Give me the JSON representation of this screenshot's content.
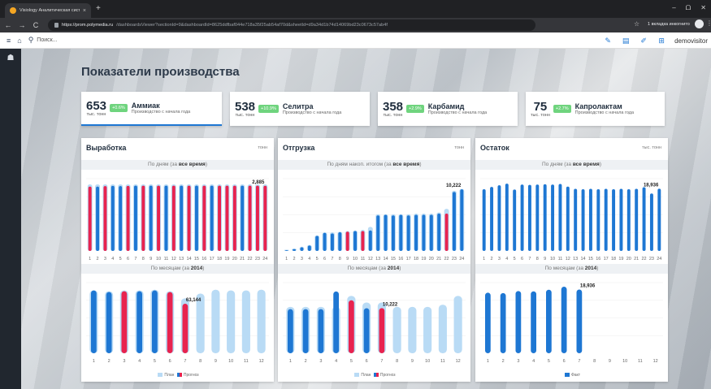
{
  "browser": {
    "tab_title": "Visiology Аналитическая систе...",
    "tab_close": "×",
    "new_tab": "+",
    "window_controls": [
      "–",
      "ᗝ",
      "✕"
    ],
    "url_host": "https://prom.polymedia.ru",
    "url_path": "/dashboardsViewer?sectionId=9&dashboardId=8625ddfbaf044e718a35f25ab54af70d&sheetId=d9a34d1b74d14069bd23c0673c57ab4f",
    "incognito_label": "1 вкладка инкогнито"
  },
  "app": {
    "search_placeholder": "Поиск...",
    "user_name": "demovisitor"
  },
  "page": {
    "title": "Показатели производства"
  },
  "kpis": [
    {
      "value": "653",
      "unit": "тыс. тонн",
      "badge": "+0.6%",
      "name": "Аммиак",
      "subtitle": "Производство с начала года",
      "active": true
    },
    {
      "value": "538",
      "unit": "тыс. тонн",
      "badge": "+10.9%",
      "name": "Селитра",
      "subtitle": "Производство с начала года",
      "active": false
    },
    {
      "value": "358",
      "unit": "тыс. тонн",
      "badge": "+2.9%",
      "name": "Карбамид",
      "subtitle": "Производство с начала года",
      "active": false
    },
    {
      "value": "75",
      "unit": "тыс. тонн",
      "badge": "+2.7%",
      "name": "Капролактам",
      "subtitle": "Производство с начала года",
      "active": false
    }
  ],
  "colors": {
    "blue": "#1e77d3",
    "red": "#e8234f",
    "light_blue": "#b9dbf5",
    "badge_green": "#6fd47e"
  },
  "panels": [
    {
      "title": "Выработка",
      "unit": "тонн",
      "top_header": {
        "prefix": "По дням (за ",
        "bold": "все время",
        "suffix": ")"
      },
      "bottom_header": {
        "prefix": "По месяцам (за ",
        "bold": "2014",
        "suffix": ")"
      },
      "legend": [
        {
          "label": "План",
          "color": "#b9dbf5"
        },
        {
          "label": "Прогноз",
          "color": "#e8234f",
          "color2": "#1e77d3"
        }
      ]
    },
    {
      "title": "Отгрузка",
      "unit": "тонн",
      "top_header": {
        "prefix": "По дням накоп. итогом (за ",
        "bold": "все время",
        "suffix": ")"
      },
      "bottom_header": {
        "prefix": "По месяцам (за ",
        "bold": "2014",
        "suffix": ")"
      },
      "legend": [
        {
          "label": "План",
          "color": "#b9dbf5"
        },
        {
          "label": "Прогноз",
          "color": "#e8234f",
          "color2": "#1e77d3"
        }
      ]
    },
    {
      "title": "Остаток",
      "unit": "тыс. тонн",
      "top_header": {
        "prefix": "По дням (за ",
        "bold": "все время",
        "suffix": ")"
      },
      "bottom_header": {
        "prefix": "По месяцам (за ",
        "bold": "2014",
        "suffix": ")"
      },
      "legend": [
        {
          "label": "Факт",
          "color": "#1e77d3"
        }
      ]
    }
  ],
  "chart_data": [
    {
      "id": "vyrabotka-daily",
      "type": "bar",
      "x": [
        1,
        2,
        3,
        4,
        5,
        6,
        7,
        8,
        9,
        10,
        11,
        12,
        13,
        14,
        15,
        16,
        17,
        18,
        19,
        20,
        21,
        22,
        23,
        24
      ],
      "ylim": [
        0,
        3200
      ],
      "series": [
        {
          "values": [
            2850,
            2850,
            2870,
            2880,
            2870,
            2880,
            2890,
            2890,
            2890,
            2890,
            2890,
            2890,
            2890,
            2890,
            2890,
            2890,
            2890,
            2890,
            2890,
            2890,
            2890,
            2890,
            2890,
            2885
          ]
        }
      ],
      "plan": [
        2950,
        2950,
        2950,
        2950,
        2950,
        2950,
        2950,
        2950,
        2950,
        2950,
        2950,
        2950,
        2950,
        2950,
        2950,
        2950,
        2950,
        2950,
        2950,
        2950,
        2950,
        2950,
        2950,
        2950
      ],
      "bar_colors": [
        "red",
        "blue",
        "red",
        "blue",
        "blue",
        "red",
        "blue",
        "red",
        "blue",
        "red",
        "blue",
        "red",
        "blue",
        "red",
        "blue",
        "red",
        "blue",
        "red",
        "red",
        "red",
        "blue",
        "red",
        "red",
        "red"
      ],
      "last_label": "2,885"
    },
    {
      "id": "vyrabotka-monthly",
      "type": "bar",
      "x": [
        1,
        2,
        3,
        4,
        5,
        6,
        7,
        8,
        9,
        10,
        11,
        12
      ],
      "ylim": [
        0,
        90000
      ],
      "series": [
        {
          "name": "План",
          "values": [
            80000,
            79000,
            80000,
            80000,
            81000,
            79000,
            70000,
            76000,
            81000,
            80000,
            80000,
            81000
          ]
        },
        {
          "name": "Прогноз",
          "values": [
            80000,
            78000,
            79000,
            79000,
            80000,
            78000,
            63144,
            null,
            null,
            null,
            null,
            null
          ]
        }
      ],
      "bar_colors": [
        "blue",
        "blue",
        "red",
        "blue",
        "blue",
        "red",
        "red"
      ],
      "last_label": "63,144"
    },
    {
      "id": "otgruzka-daily",
      "type": "bar",
      "x": [
        1,
        2,
        3,
        4,
        5,
        6,
        7,
        8,
        9,
        10,
        11,
        12,
        13,
        14,
        15,
        16,
        17,
        18,
        19,
        20,
        21,
        22,
        23,
        24
      ],
      "ylim": [
        0,
        12000
      ],
      "series": [
        {
          "values": [
            120,
            300,
            600,
            900,
            2500,
            3000,
            2900,
            3100,
            3200,
            3300,
            3300,
            3400,
            5900,
            6000,
            5900,
            6000,
            5900,
            6000,
            6000,
            6000,
            6200,
            6200,
            9800,
            10222
          ]
        }
      ],
      "plan": [
        200,
        400,
        700,
        1000,
        2600,
        3100,
        3100,
        3200,
        3300,
        3400,
        3500,
        4000,
        6100,
        6100,
        6100,
        6100,
        6100,
        6200,
        6200,
        6200,
        6400,
        7000,
        10000,
        10300
      ],
      "bar_colors": [
        "blue",
        "blue",
        "blue",
        "blue",
        "blue",
        "blue",
        "blue",
        "blue",
        "red",
        "blue",
        "red",
        "blue",
        "blue",
        "blue",
        "blue",
        "blue",
        "blue",
        "blue",
        "blue",
        "blue",
        "blue",
        "red",
        "blue",
        "blue"
      ],
      "last_label": "10,222"
    },
    {
      "id": "otgruzka-monthly",
      "type": "bar",
      "x": [
        1,
        2,
        3,
        4,
        5,
        6,
        7,
        8,
        9,
        10,
        11,
        12
      ],
      "ylim": [
        0,
        16000
      ],
      "series": [
        {
          "name": "План",
          "values": [
            10500,
            10500,
            10500,
            10500,
            13000,
            11500,
            11500,
            10500,
            10500,
            10500,
            11000,
            13000
          ]
        },
        {
          "name": "Прогноз",
          "values": [
            10000,
            10000,
            10000,
            14000,
            12000,
            10200,
            10222,
            null,
            null,
            null,
            null,
            null
          ]
        }
      ],
      "bar_colors": [
        "blue",
        "blue",
        "blue",
        "blue",
        "red",
        "blue",
        "red"
      ],
      "last_label": "10,222"
    },
    {
      "id": "ostatok-daily",
      "type": "bar",
      "x": [
        1,
        2,
        3,
        4,
        5,
        6,
        7,
        8,
        9,
        10,
        11,
        12,
        13,
        14,
        15,
        16,
        17,
        18,
        19,
        20,
        21,
        22,
        23,
        24
      ],
      "ylim": [
        0,
        22000
      ],
      "series": [
        {
          "values": [
            18800,
            19500,
            20000,
            20500,
            18700,
            20200,
            20100,
            20200,
            20300,
            20200,
            20400,
            19600,
            18900,
            18800,
            18900,
            18800,
            18900,
            18800,
            18900,
            18800,
            18900,
            19400,
            17500,
            18936
          ]
        }
      ],
      "bar_colors": [
        "blue"
      ],
      "last_label": "18,936"
    },
    {
      "id": "ostatok-monthly",
      "type": "bar",
      "x": [
        1,
        2,
        3,
        4,
        5,
        6,
        7,
        8,
        9,
        10,
        11,
        12
      ],
      "ylim": [
        0,
        21000
      ],
      "series": [
        {
          "name": "Факт",
          "values": [
            18000,
            17900,
            18500,
            18400,
            18900,
            19800,
            18936,
            null,
            null,
            null,
            null,
            null
          ]
        }
      ],
      "bar_colors": [
        "blue"
      ],
      "last_label": "18,936"
    }
  ]
}
